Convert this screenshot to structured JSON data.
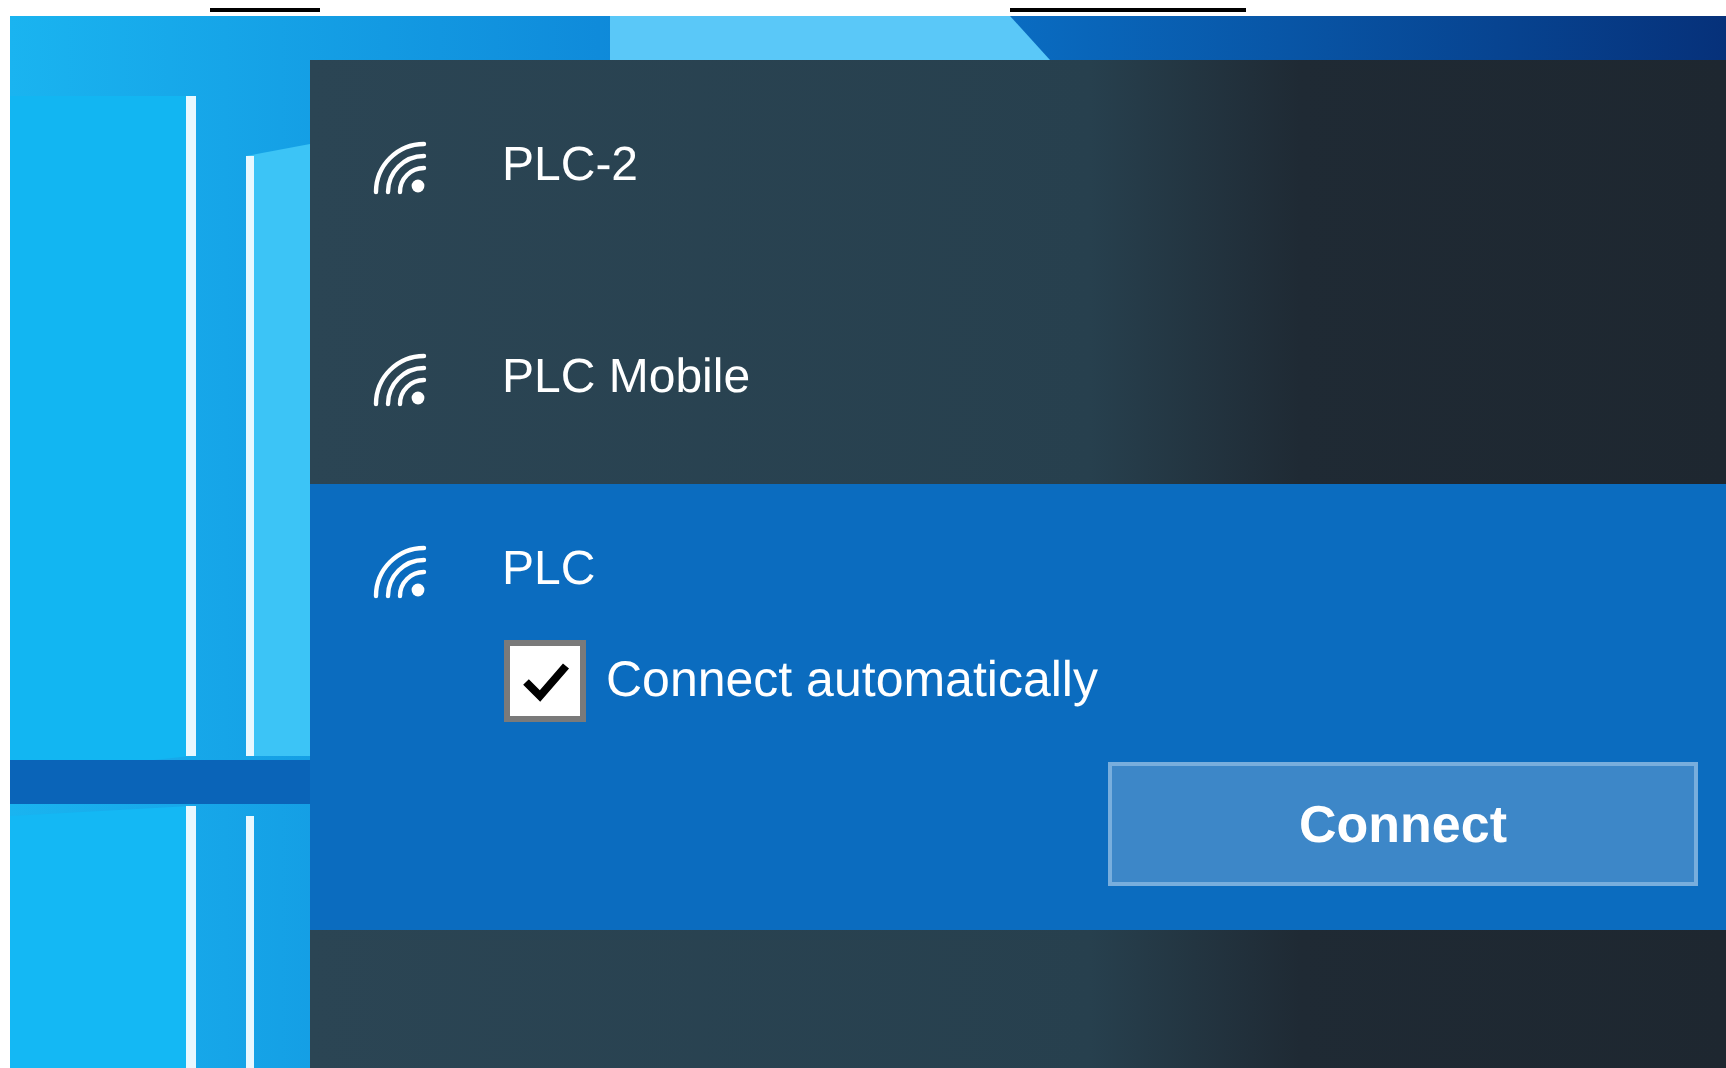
{
  "networks": [
    {
      "name": "PLC-2",
      "selected": false
    },
    {
      "name": "PLC Mobile",
      "selected": false
    },
    {
      "name": "PLC",
      "selected": true,
      "auto_connect": {
        "label": "Connect automatically",
        "checked": true
      },
      "button": "Connect"
    }
  ]
}
